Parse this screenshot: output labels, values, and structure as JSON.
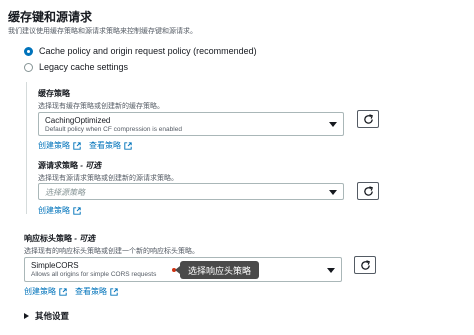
{
  "section": {
    "title": "缓存键和源请求",
    "description": "我们建议使用缓存策略和源请求策略来控制缓存键和源请求。"
  },
  "options": [
    {
      "label": "Cache policy and origin request policy (recommended)",
      "selected": true
    },
    {
      "label": "Legacy cache settings",
      "selected": false
    }
  ],
  "cache_policy": {
    "label": "缓存策略",
    "help": "选择现有缓存策略或创建新的缓存策略。",
    "selected_name": "CachingOptimized",
    "selected_desc": "Default policy when CF compression is enabled",
    "create_link": "创建策略",
    "view_link": "查看策略"
  },
  "origin_policy": {
    "label": "源请求策略",
    "label_suffix": " - 可选",
    "help": "选择现有源请求策略或创建新的源请求策略。",
    "placeholder": "选择源策略",
    "create_link": "创建策略"
  },
  "response_policy": {
    "label": "响应标头策略",
    "label_suffix": " - 可选",
    "help": "选择现有的响应标头策略或创建一个新的响应标头策略。",
    "selected_name": "SimpleCORS",
    "selected_desc": "Allows all origins for simple CORS requests",
    "create_link": "创建策略",
    "view_link": "查看策略",
    "tooltip": "选择响应头策略"
  },
  "other_settings": "其他设置",
  "colors": {
    "link": "#0073bb",
    "radio": "#0073bb",
    "tooltip": "#4a4a4a",
    "dot": "#d13212"
  },
  "icons": [
    "refresh-icon",
    "external-link-icon",
    "caret-down-icon",
    "caret-right-icon"
  ]
}
